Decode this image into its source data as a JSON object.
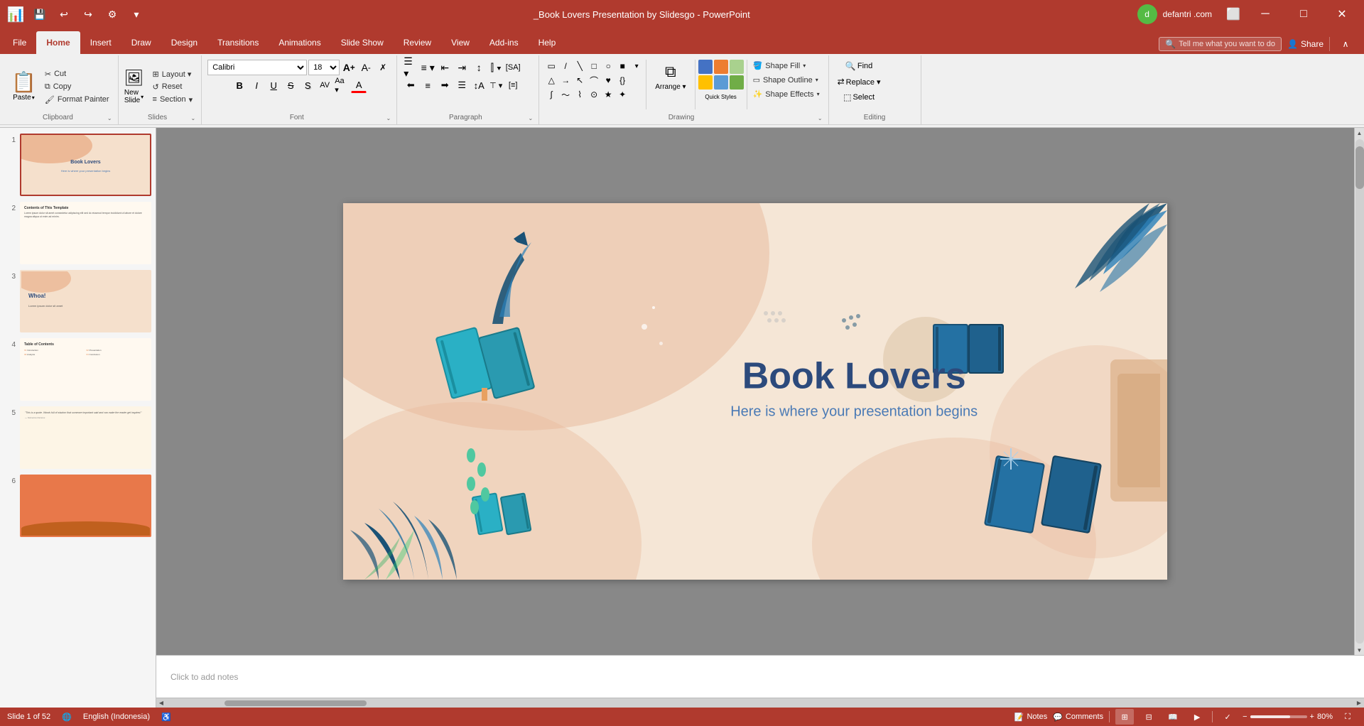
{
  "titleBar": {
    "title": "_Book Lovers Presentation by Slidesgo - PowerPoint",
    "user": "defantri .com",
    "minLabel": "─",
    "maxLabel": "□",
    "closeLabel": "✕"
  },
  "quickAccess": {
    "saveIcon": "💾",
    "undoIcon": "↩",
    "redoIcon": "↪",
    "customizeIcon": "⚙",
    "dropIcon": "▾"
  },
  "tabs": [
    {
      "label": "File",
      "active": false
    },
    {
      "label": "Home",
      "active": true
    },
    {
      "label": "Insert",
      "active": false
    },
    {
      "label": "Draw",
      "active": false
    },
    {
      "label": "Design",
      "active": false
    },
    {
      "label": "Transitions",
      "active": false
    },
    {
      "label": "Animations",
      "active": false
    },
    {
      "label": "Slide Show",
      "active": false
    },
    {
      "label": "Review",
      "active": false
    },
    {
      "label": "View",
      "active": false
    },
    {
      "label": "Add-ins",
      "active": false
    },
    {
      "label": "Help",
      "active": false
    }
  ],
  "ribbon": {
    "clipboardGroup": {
      "label": "Clipboard",
      "pasteLabel": "Paste",
      "cutLabel": "Cut",
      "copyLabel": "Copy",
      "formatPainterLabel": "Format Painter",
      "expandLabel": "⌄"
    },
    "slidesGroup": {
      "label": "Slides",
      "newSlideLabel": "New\nSlide",
      "layoutLabel": "Layout",
      "resetLabel": "Reset",
      "sectionLabel": "Section",
      "expandLabel": "⌄"
    },
    "fontGroup": {
      "label": "Font",
      "fontName": "Calibri",
      "fontSize": "18",
      "boldLabel": "B",
      "italicLabel": "I",
      "underlineLabel": "U",
      "strikeLabel": "S",
      "shadowLabel": "S",
      "charSpacingLabel": "AV",
      "changeCaseLabel": "Aa",
      "clearFormattingLabel": "✗",
      "fontColorLabel": "A",
      "growLabel": "A↑",
      "shrinkLabel": "A↓",
      "expandLabel": "⌄"
    },
    "paragraphGroup": {
      "label": "Paragraph",
      "expandLabel": "⌄"
    },
    "drawingGroup": {
      "label": "Drawing",
      "arrangeLabel": "Arrange",
      "quickStylesLabel": "Quick\nStyles",
      "shapeFillLabel": "Shape Fill",
      "shapeOutlineLabel": "Shape Outline",
      "shapeEffectsLabel": "Shape Effects",
      "expandLabel": "⌄"
    },
    "editingGroup": {
      "label": "Editing",
      "findLabel": "Find",
      "replaceLabel": "Replace",
      "selectLabel": "Select",
      "searchPlaceholder": "Tell me what you want to do"
    }
  },
  "slidePanel": {
    "slides": [
      {
        "num": 1,
        "active": true,
        "type": "title"
      },
      {
        "num": 2,
        "active": false,
        "type": "contents"
      },
      {
        "num": 3,
        "active": false,
        "type": "whoa"
      },
      {
        "num": 4,
        "active": false,
        "type": "table"
      },
      {
        "num": 5,
        "active": false,
        "type": "quote"
      },
      {
        "num": 6,
        "active": false,
        "type": "orange"
      }
    ]
  },
  "canvas": {
    "title": "Book Lovers",
    "subtitle": "Here is where your presentation begins",
    "backgroundColor": "#f5e6d6"
  },
  "notes": {
    "placeholder": "Click to add notes",
    "label": "Notes"
  },
  "comments": {
    "label": "Comments"
  },
  "statusBar": {
    "slideInfo": "Slide 1 of 52",
    "language": "English (Indonesia)",
    "notesLabel": "Notes",
    "commentsLabel": "Comments",
    "zoom": "80%",
    "zoomLevel": 80
  }
}
